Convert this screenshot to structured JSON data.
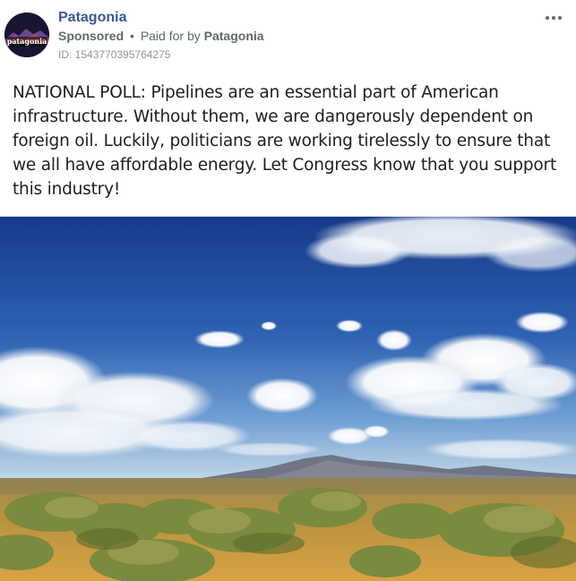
{
  "post": {
    "page_name": "Patagonia",
    "avatar_text": "patagonia",
    "sponsored_label": "Sponsored",
    "separator": "•",
    "paid_for_prefix": "Paid for by",
    "paid_for_name": "Patagonia",
    "id_label": "ID: 1543770395764275",
    "body_text": "NATIONAL POLL: Pipelines are an essential part of American infrastructure. Without them, we are dangerously dependent on foreign oil. Luckily, politicians are working tirelessly to ensure that we all have affordable energy. Let Congress know that you support this industry!",
    "more_icon": "ellipsis-horizontal-icon",
    "image_description_icon": "landscape-photo"
  },
  "colors": {
    "page_name": "#385898",
    "meta": "#606770",
    "id": "#90949c",
    "body": "#1c1e21",
    "sky_top": "#1b3f8f",
    "sky_bottom": "#4f86c6",
    "ground": "#b08a3e"
  }
}
